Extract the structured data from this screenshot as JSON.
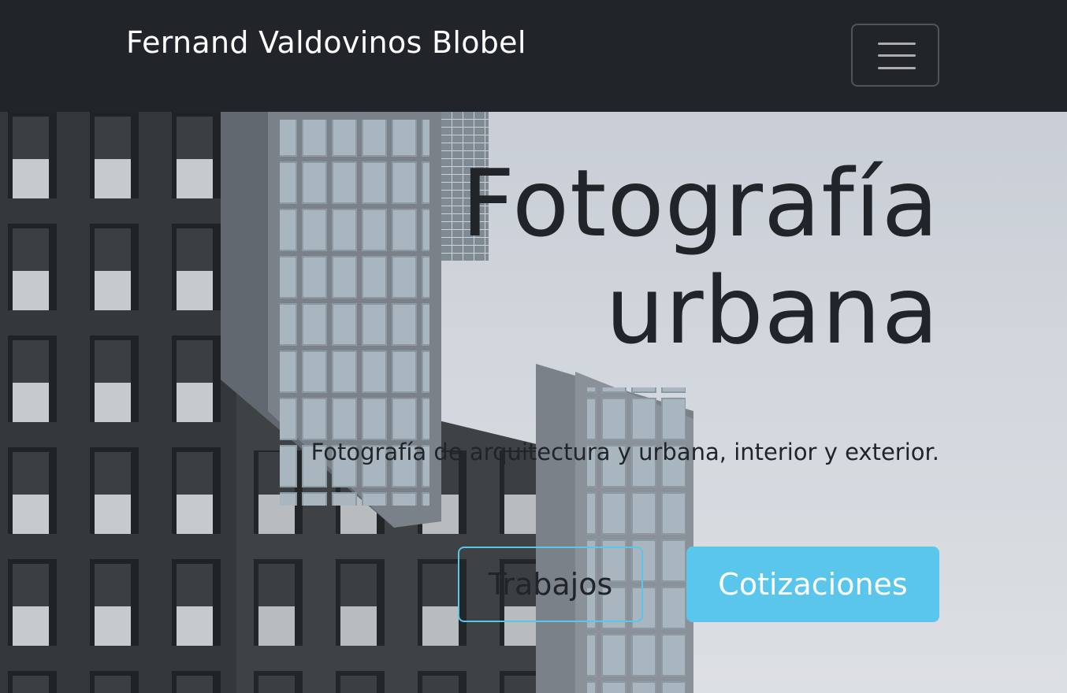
{
  "navbar": {
    "brand": "Fernand Valdovinos Blobel",
    "toggler_icon": "hamburger-menu-icon"
  },
  "hero": {
    "title_line1": "Fotografía",
    "title_line2": "urbana",
    "lead": "Fotografía de arquitectura y urbana, interior y exterior.",
    "buttons": {
      "works": "Trabajos",
      "quotes": "Cotizaciones"
    }
  },
  "colors": {
    "navbar_bg": "#212529",
    "accent": "#5bc6ec",
    "text_dark": "#212529"
  }
}
